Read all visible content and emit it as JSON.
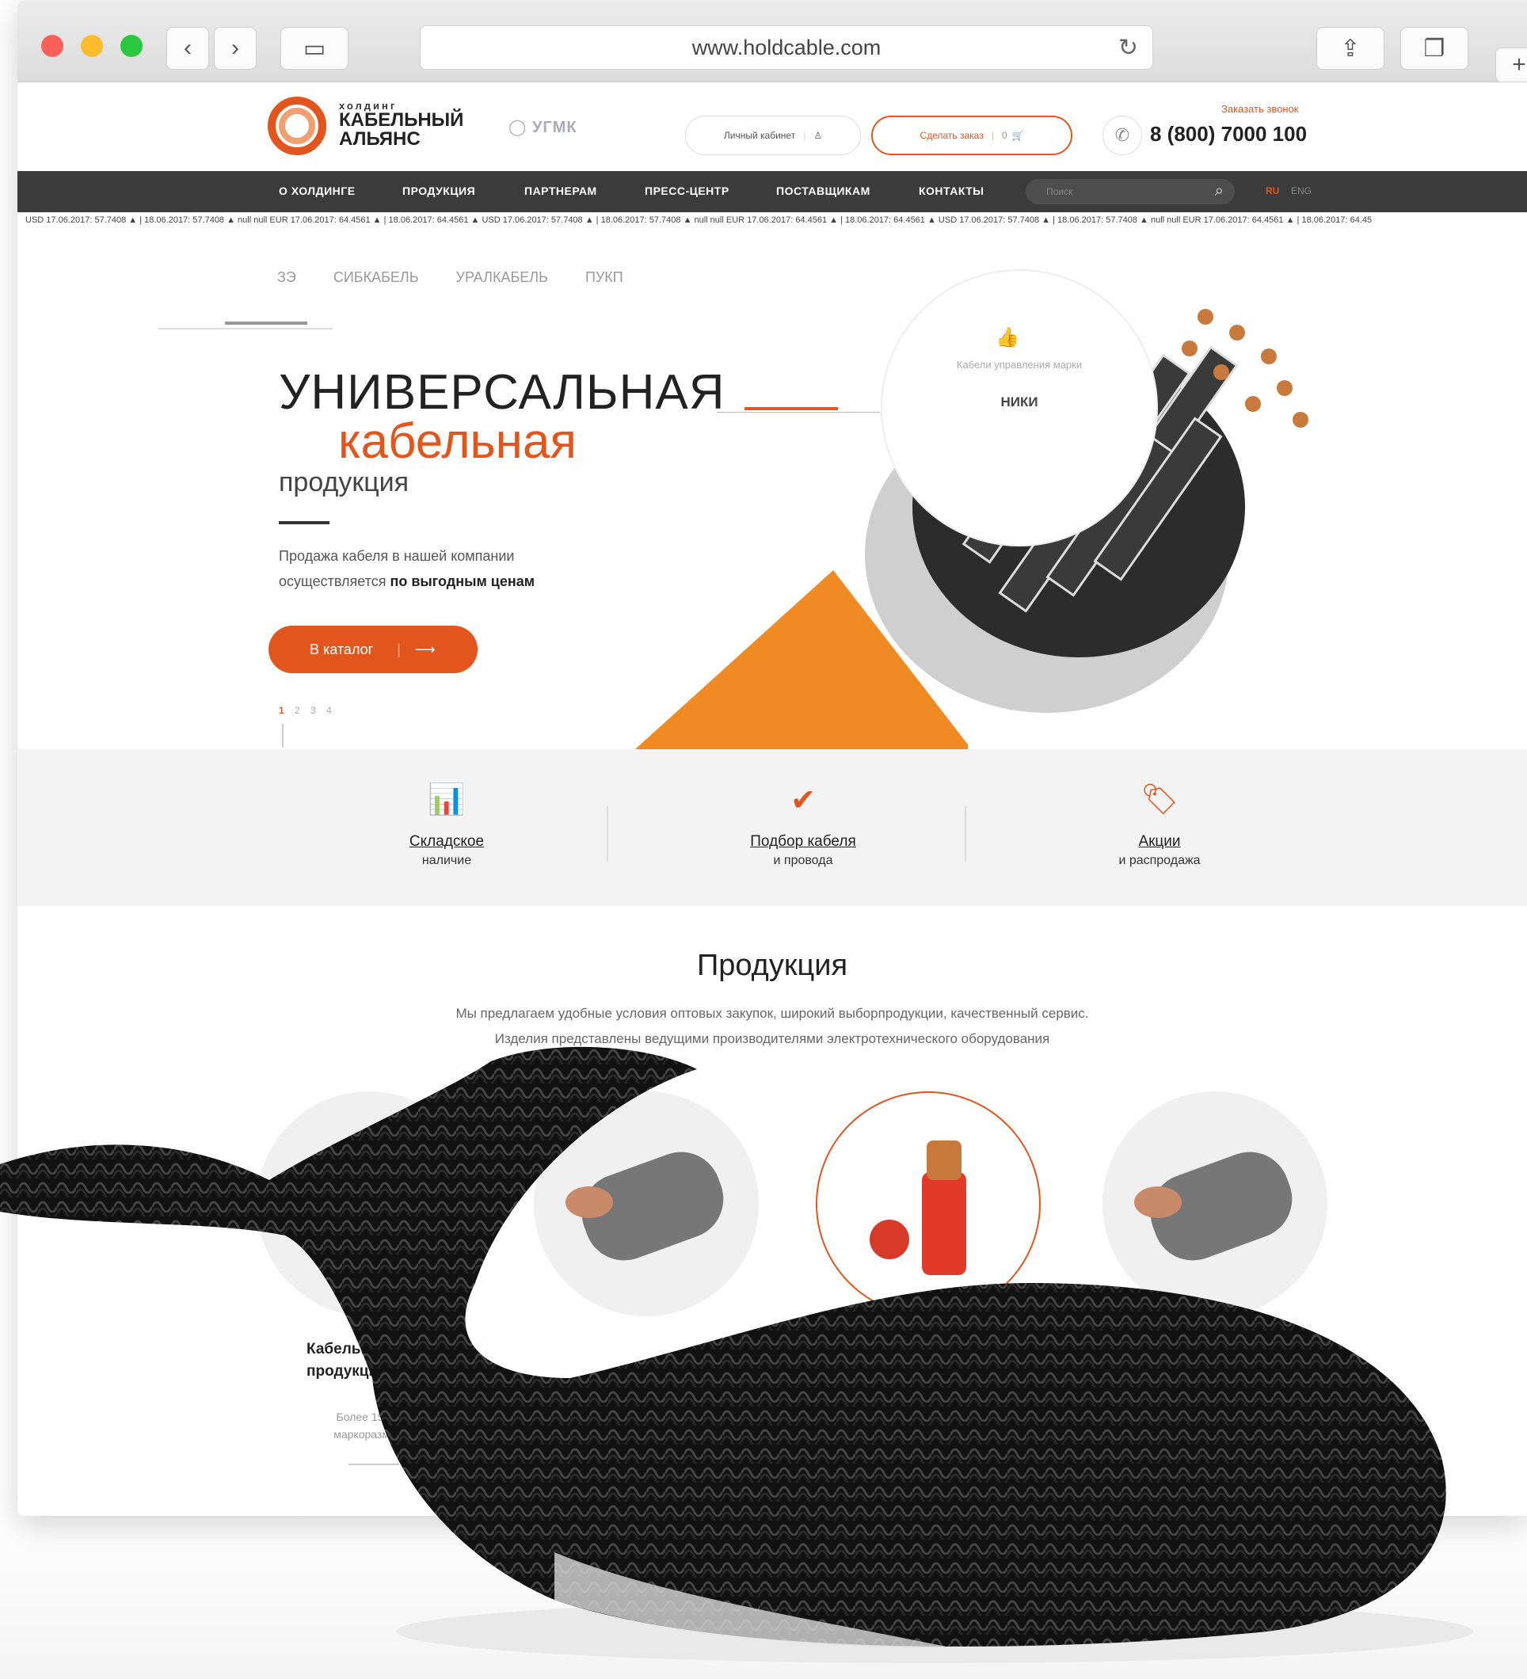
{
  "browser": {
    "url": "www.holdcable.com"
  },
  "header": {
    "logo_top": "холдинг",
    "logo_line1": "КАБЕЛЬНЫЙ",
    "logo_line2": "АЛЬЯНС",
    "partner_logo": "УГМК",
    "cabinet_label": "Личный кабинет",
    "order_label": "Сделать заказ",
    "cart_count": "0",
    "callback_label": "Заказать звонок",
    "phone": "8 (800) 7000 100"
  },
  "nav": {
    "items": [
      "О ХОЛДИНГЕ",
      "ПРОДУКЦИЯ",
      "ПАРТНЕРАМ",
      "ПРЕСС-ЦЕНТР",
      "ПОСТАВЩИКАМ",
      "КОНТАКТЫ"
    ],
    "search_placeholder": "Поиск",
    "lang_ru": "RU",
    "lang_en": "ENG"
  },
  "ticker": {
    "text": "USD 17.06.2017: 57.7408 ▲ | 18.06.2017: 57.7408 ▲   null null   EUR 17.06.2017: 64.4561 ▲ | 18.06.2017: 64.4561 ▲   USD 17.06.2017: 57.7408 ▲ | 18.06.2017: 57.7408 ▲   null null   EUR 17.06.2017: 64.4561 ▲ | 18.06.2017: 64.4561 ▲   USD 17.06.2017: 57.7408 ▲ | 18.06.2017: 57.7408 ▲   null null   EUR 17.06.2017: 64.4561 ▲ | 18.06.2017: 64.45"
  },
  "hero": {
    "brands": [
      "ЗЭ",
      "СИБКАБЕЛЬ",
      "УРАЛКАБЕЛЬ",
      "ПУКП"
    ],
    "title_line1": "УНИВЕРСАЛЬНАЯ",
    "title_line2": "кабельная",
    "title_line3": "продукция",
    "desc_line1": "Продажа кабеля в нашей компании",
    "desc_line2_prefix": "осуществляется ",
    "desc_line2_bold": "по выгодным ценам",
    "cta_label": "В каталог",
    "pager": [
      "1",
      "2",
      "3",
      "4"
    ],
    "info_small": "Кабели управления марки",
    "info_big": "НИКИ"
  },
  "features": [
    {
      "title": "Складское",
      "subtitle": "наличие",
      "icon": "chart-icon"
    },
    {
      "title": "Подбор кабеля",
      "subtitle": "и провода",
      "icon": "check-circle-icon"
    },
    {
      "title": "Акции",
      "subtitle": "и распродажа",
      "icon": "tag-icon"
    }
  ],
  "products": {
    "title": "Продукция",
    "desc_line1": "Мы предлагаем удобные условия оптовых закупок, широкий выборпродукции, качественный сервис.",
    "desc_line2": "Изделия представлены ведущими производителями электротехнического оборудования",
    "first_card_name_line1": "Кабельная",
    "first_card_name_line2": "продукция",
    "first_card_sub_line1": "Более 150 000",
    "first_card_sub_line2": "маркоразмеров"
  },
  "colors": {
    "accent": "#e2561e",
    "nav_bg": "#3b3b3b",
    "band_bg": "#f3f3f3"
  }
}
